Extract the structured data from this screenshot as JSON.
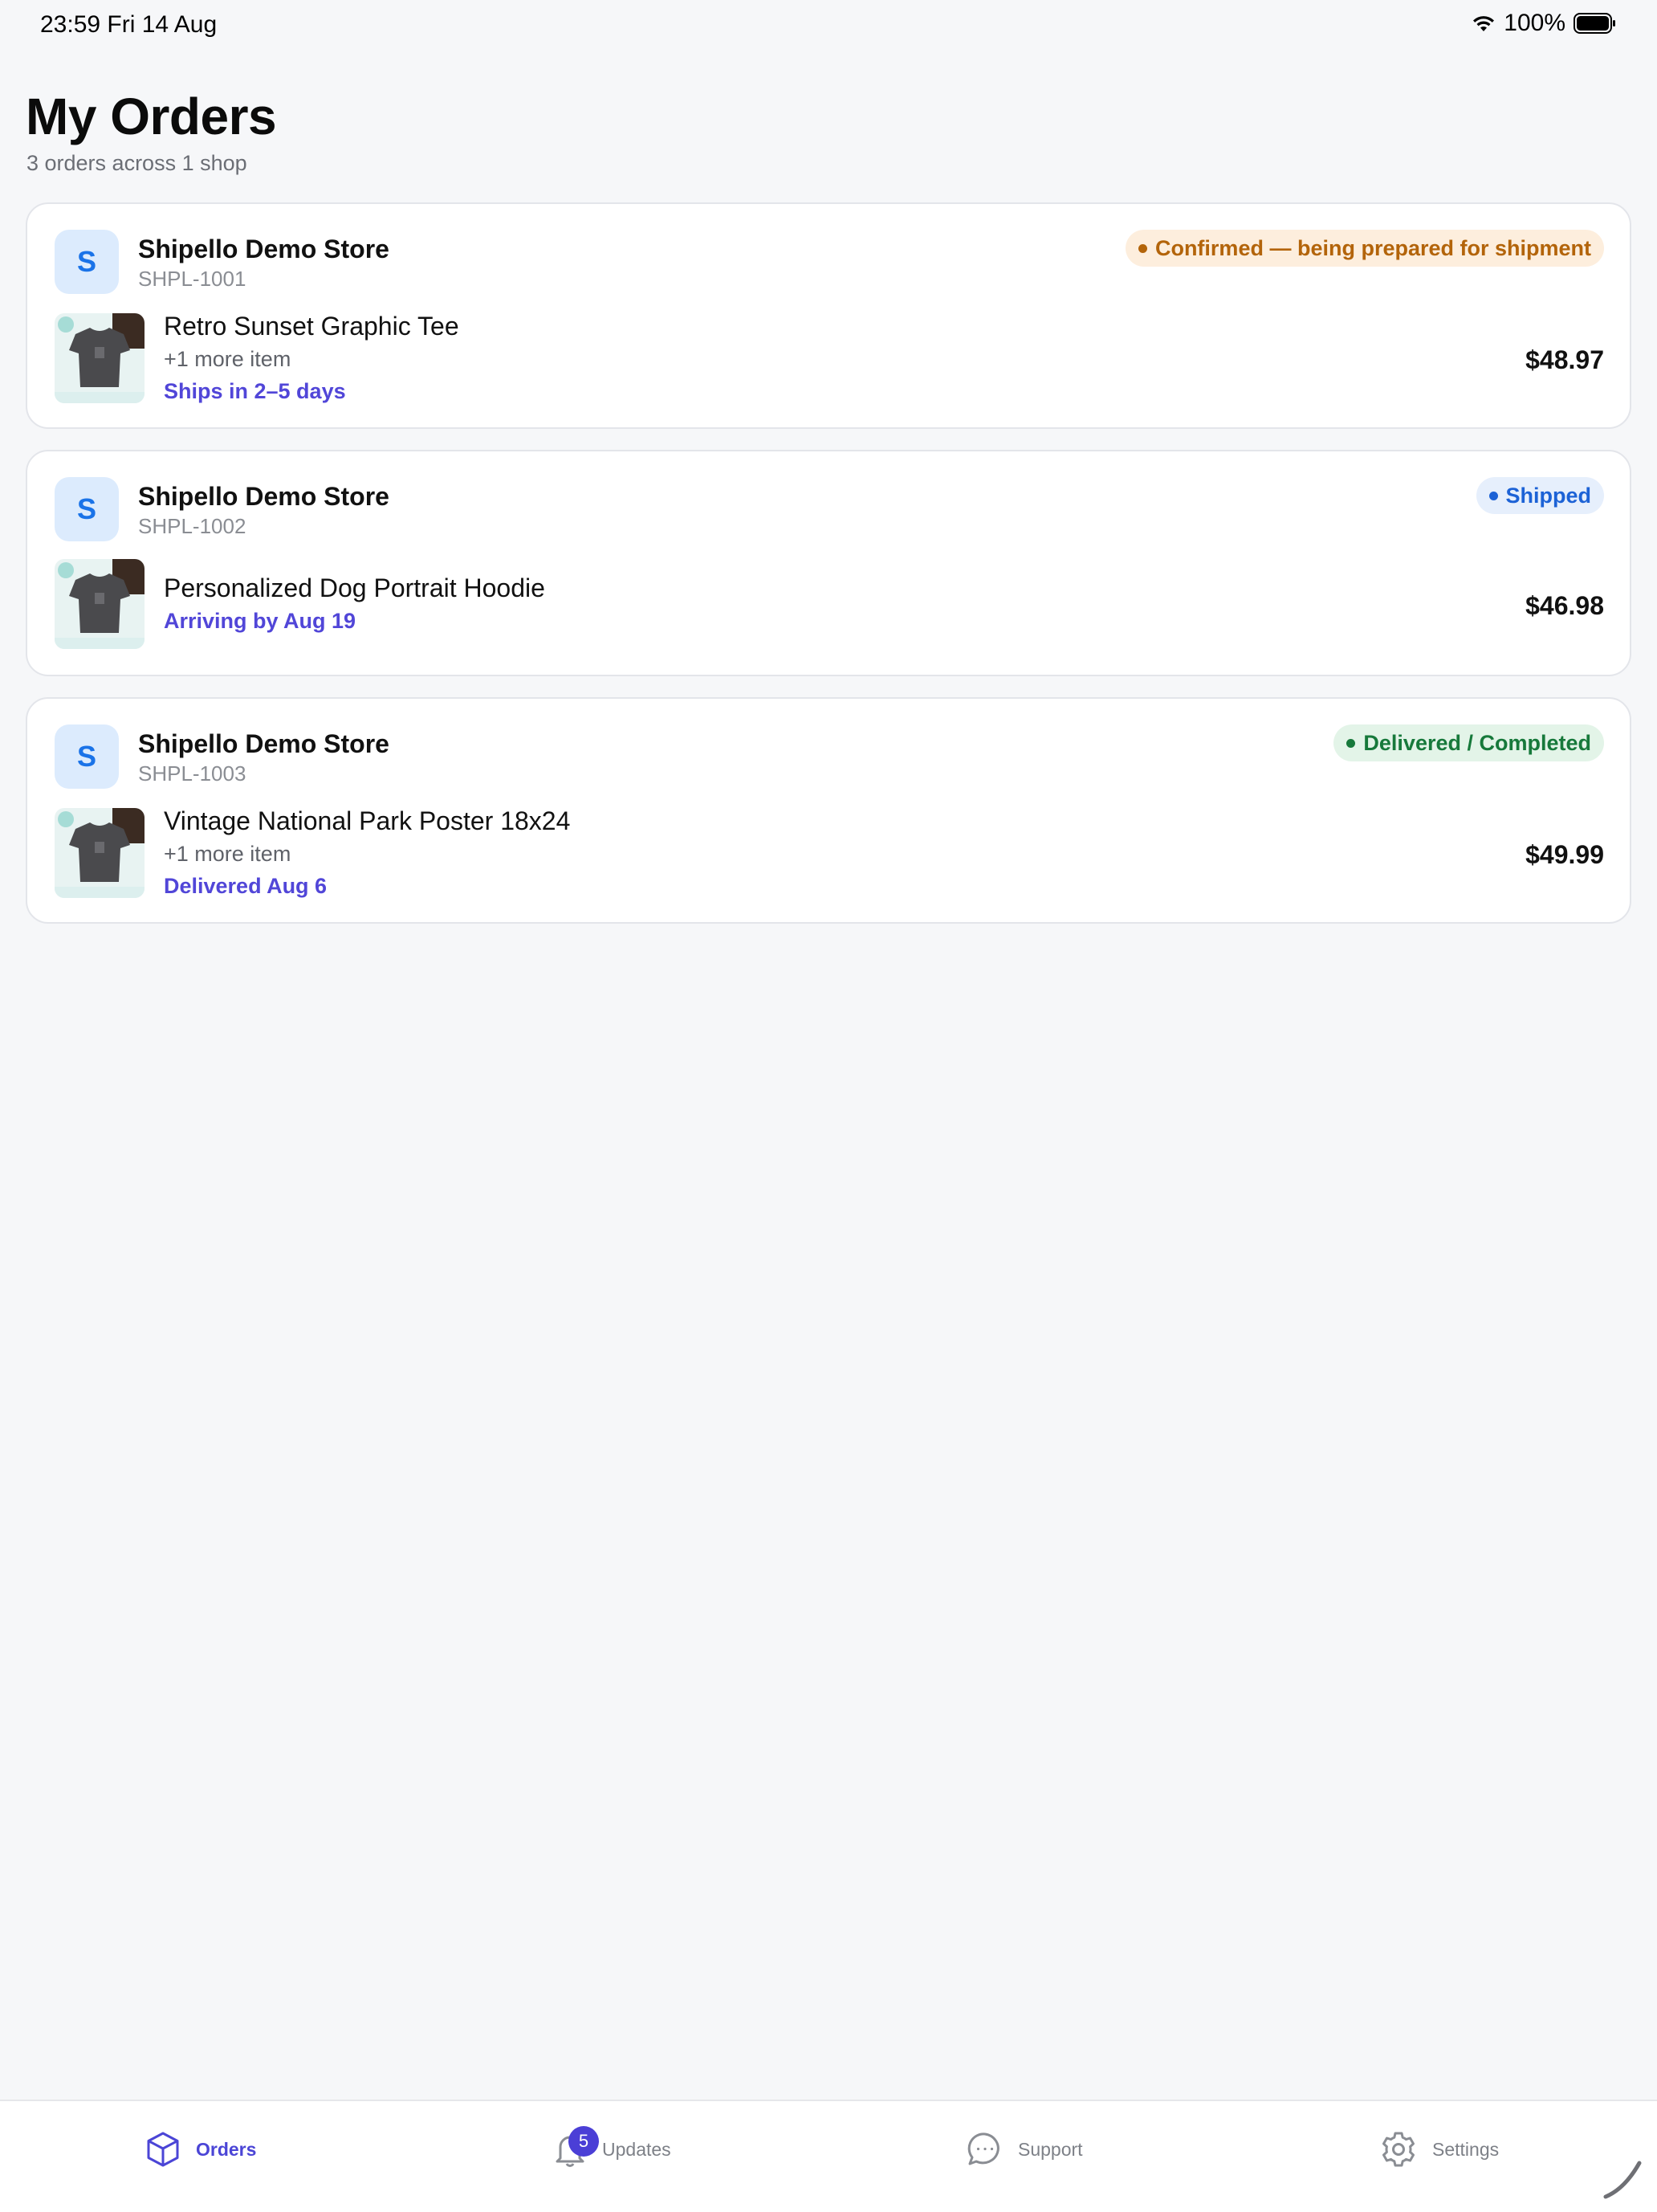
{
  "status_bar": {
    "time": "23:59  Fri 14 Aug",
    "battery": "100%"
  },
  "header": {
    "title": "My Orders",
    "subtitle": "3 orders across 1 shop"
  },
  "orders": [
    {
      "avatar_letter": "S",
      "store": "Shipello Demo Store",
      "order_id": "SHPL-1001",
      "status": "Confirmed — being prepared for shipment",
      "status_color": "#b3640a",
      "status_bg": "#fdeedd",
      "product": "Retro Sunset Graphic Tee",
      "more_items": "+1 more item",
      "delivery": "Ships in 2–5 days",
      "price": "$48.97"
    },
    {
      "avatar_letter": "S",
      "store": "Shipello Demo Store",
      "order_id": "SHPL-1002",
      "status": "Shipped",
      "status_color": "#1c62d6",
      "status_bg": "#e6effc",
      "product": "Personalized Dog Portrait Hoodie",
      "more_items": "",
      "delivery": "Arriving by Aug 19",
      "price": "$46.98"
    },
    {
      "avatar_letter": "S",
      "store": "Shipello Demo Store",
      "order_id": "SHPL-1003",
      "status": "Delivered / Completed",
      "status_color": "#17793b",
      "status_bg": "#e3f4e8",
      "product": "Vintage National Park Poster 18x24",
      "more_items": "+1 more item",
      "delivery": "Delivered Aug 6",
      "price": "$49.99"
    }
  ],
  "tab_bar": {
    "tabs": [
      {
        "label": "Orders",
        "icon": "box-icon",
        "active": true
      },
      {
        "label": "Updates",
        "icon": "bell-icon",
        "badge": "5"
      },
      {
        "label": "Support",
        "icon": "chat-icon"
      },
      {
        "label": "Settings",
        "icon": "gear-icon"
      }
    ]
  },
  "colors": {
    "accent": "#4b45d6",
    "background": "#f6f7f9"
  }
}
